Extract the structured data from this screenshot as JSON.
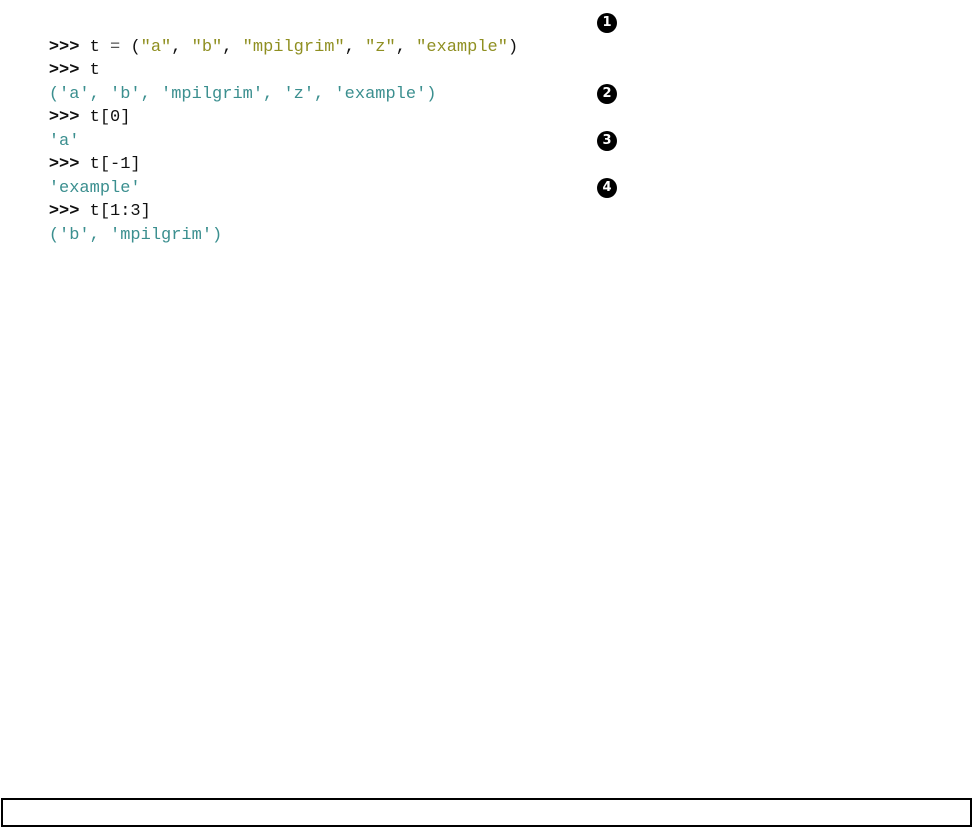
{
  "session": {
    "lines": [
      {
        "prompt": ">>>",
        "code_pre": "t",
        "op": "=",
        "paren_open": "(",
        "items": [
          "\"a\"",
          "\"b\"",
          "\"mpilgrim\"",
          "\"z\"",
          "\"example\""
        ],
        "separator": ", ",
        "paren_close": ")",
        "marker": "1"
      },
      {
        "prompt": ">>>",
        "code": "t"
      },
      {
        "output": "('a', 'b', 'mpilgrim', 'z', 'example')"
      },
      {
        "prompt": ">>>",
        "code": "t[0]",
        "marker": "2"
      },
      {
        "output": "'a'"
      },
      {
        "prompt": ">>>",
        "code": "t[-1]",
        "marker": "3"
      },
      {
        "output": "'example'"
      },
      {
        "prompt": ">>>",
        "code": "t[1:3]",
        "marker": "4"
      },
      {
        "output": "('b', 'mpilgrim')"
      }
    ]
  },
  "input_bar": {
    "value": ""
  },
  "colors": {
    "prompt": "#111111",
    "string": "#8f8f21",
    "output": "#3b8f8f",
    "marker_bg": "#000000",
    "marker_fg": "#ffffff"
  }
}
